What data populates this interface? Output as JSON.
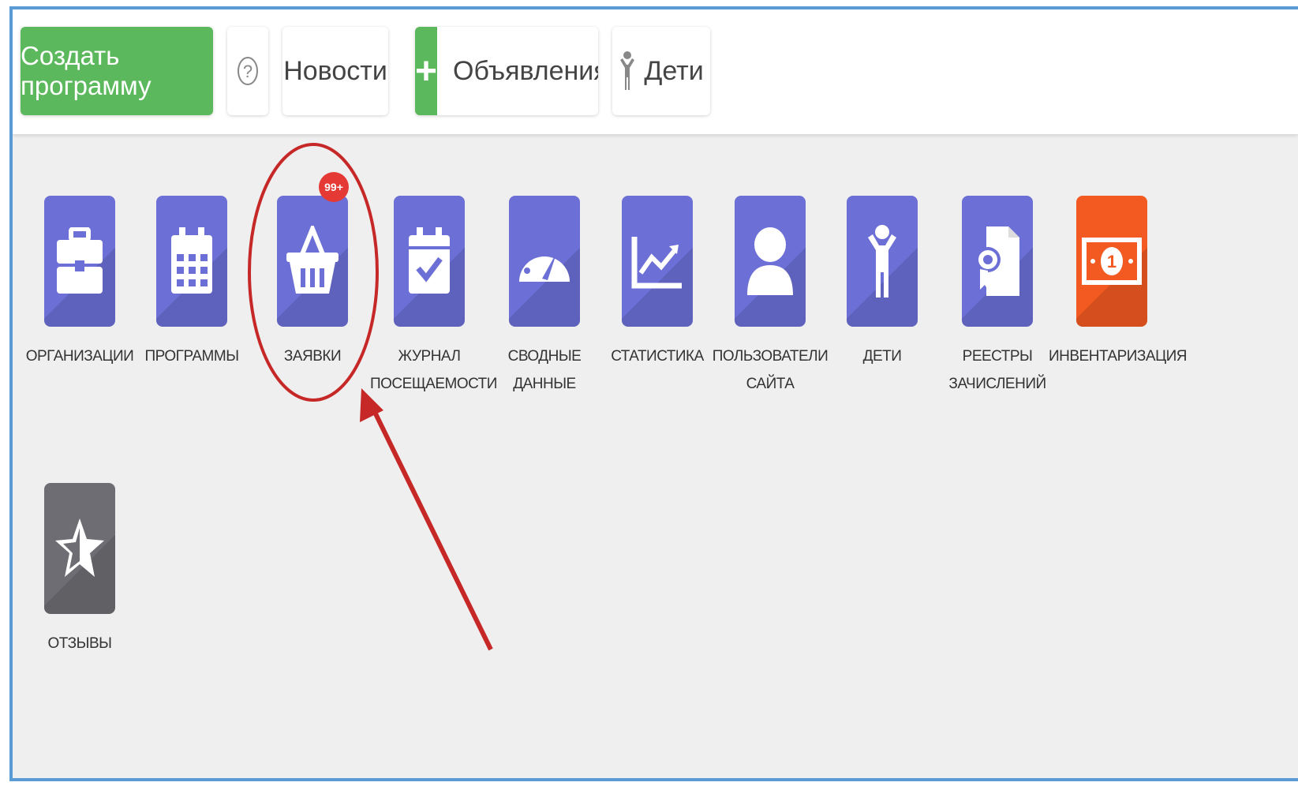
{
  "toolbar": {
    "create_label": "Создать программу",
    "help_symbol": "?",
    "news_label": "Новости",
    "ads_plus": "+",
    "ads_label": "Объявления",
    "kids_label": "Дети"
  },
  "tiles": [
    {
      "line1": "ОРГАНИЗАЦИИ",
      "line2": "",
      "icon": "briefcase-icon"
    },
    {
      "line1": "ПРОГРАММЫ",
      "line2": "",
      "icon": "calendar-icon"
    },
    {
      "line1": "ЗАЯВКИ",
      "line2": "",
      "icon": "basket-icon",
      "badge": "99+"
    },
    {
      "line1": "ЖУРНАЛ",
      "line2": "ПОСЕЩАЕМОСТИ",
      "icon": "calendar-check-icon"
    },
    {
      "line1": "СВОДНЫЕ",
      "line2": "ДАННЫЕ",
      "icon": "gauge-icon"
    },
    {
      "line1": "СТАТИСТИКА",
      "line2": "",
      "icon": "chart-icon"
    },
    {
      "line1": "ПОЛЬЗОВАТЕЛИ",
      "line2": "САЙТА",
      "icon": "user-icon"
    },
    {
      "line1": "ДЕТИ",
      "line2": "",
      "icon": "child-icon"
    },
    {
      "line1": "РЕЕСТРЫ",
      "line2": "ЗАЧИСЛЕНИЙ",
      "icon": "certificate-icon"
    },
    {
      "line1": "ИНВЕНТАРИЗАЦИЯ",
      "line2": "",
      "icon": "money-icon"
    },
    {
      "line1": "ОТЗЫВЫ",
      "line2": "",
      "icon": "star-icon"
    }
  ],
  "colors": {
    "green": "#5cb85c",
    "tile": "#6c6fd6",
    "orange": "#f25a22",
    "gray": "#6d6d73",
    "badge": "#e53935",
    "annotation": "#c62828"
  }
}
